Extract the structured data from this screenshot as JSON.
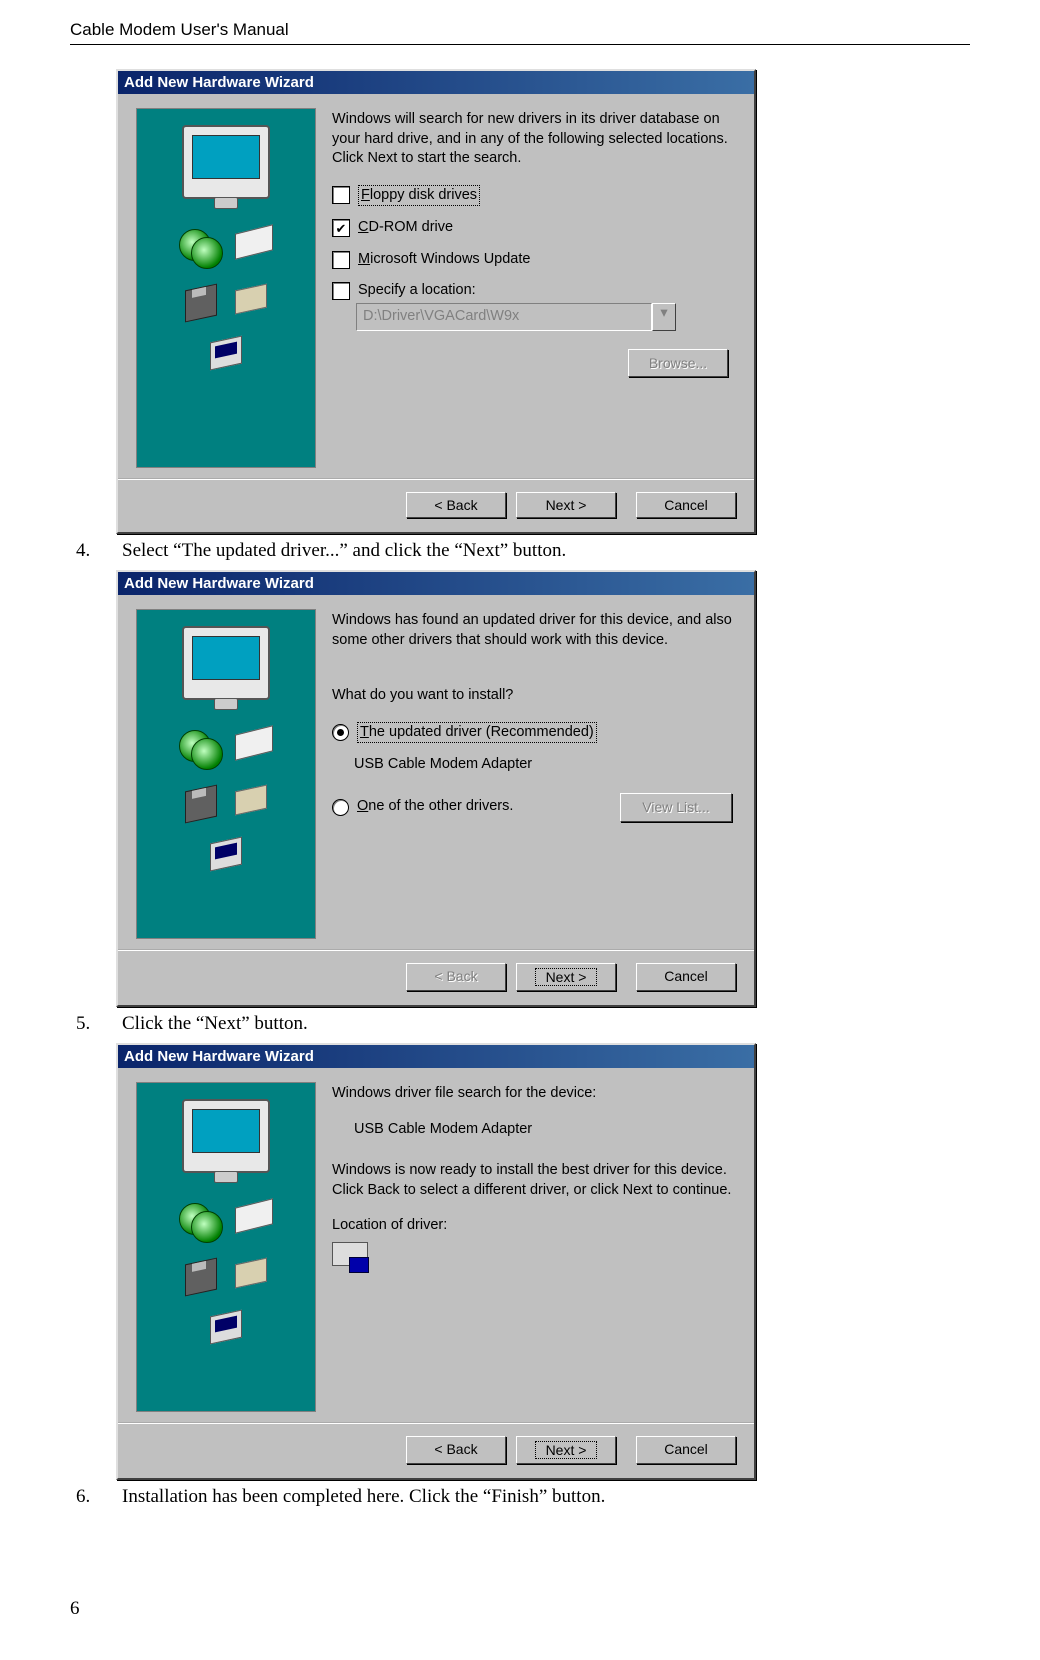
{
  "header": "Cable Modem User's Manual",
  "page_number": "6",
  "steps": {
    "s4": {
      "num": "4.",
      "text": "Select “The updated driver...” and click the “Next” button."
    },
    "s5": {
      "num": "5.",
      "text": "Click the “Next” button."
    },
    "s6": {
      "num": "6.",
      "text": "Installation has been completed here. Click the “Finish” button."
    }
  },
  "dlg1": {
    "title": "Add New Hardware Wizard",
    "intro": "Windows will search for new drivers in its driver database on your hard drive, and in any of the following selected locations. Click Next to start the search.",
    "opt_floppy": "Floppy disk drives",
    "opt_cdrom": "CD-ROM drive",
    "opt_winupdate": "Microsoft Windows Update",
    "opt_specify": "Specify a location:",
    "path": "D:\\Driver\\VGACard\\W9x",
    "browse": "Browse...",
    "back": "< Back",
    "next": "Next >",
    "cancel": "Cancel"
  },
  "dlg2": {
    "title": "Add New Hardware Wizard",
    "intro": "Windows has found an updated driver for this device, and also some other drivers that should work with this device.",
    "question": "What do you want to install?",
    "opt_updated": "The updated driver (Recommended)",
    "device_name": "USB Cable Modem Adapter",
    "opt_other": "One of the other drivers.",
    "viewlist": "View List...",
    "back": "< Back",
    "next": "Next >",
    "cancel": "Cancel"
  },
  "dlg3": {
    "title": "Add New Hardware Wizard",
    "line1": "Windows driver file search for the device:",
    "device_name": "USB Cable Modem Adapter",
    "line2": "Windows is now ready to install the best driver for this device. Click Back to select a different driver, or click Next to continue.",
    "loc_label": "Location of driver:",
    "back": "< Back",
    "next": "Next >",
    "cancel": "Cancel"
  }
}
